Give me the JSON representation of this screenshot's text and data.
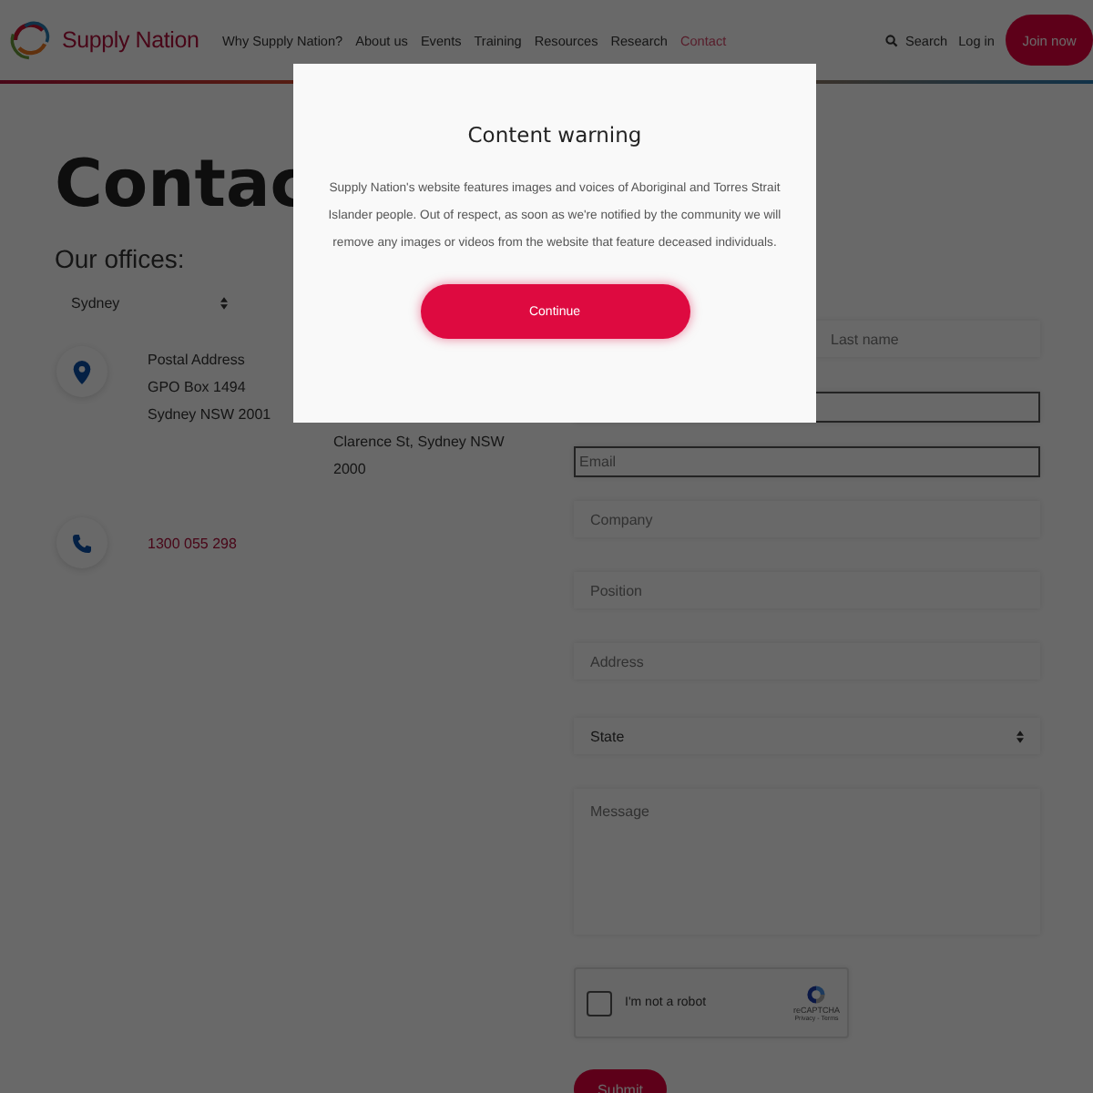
{
  "header": {
    "brand": "Supply Nation",
    "nav": [
      {
        "label": "Why Supply Nation?",
        "selected": false
      },
      {
        "label": "About us",
        "selected": false
      },
      {
        "label": "Events",
        "selected": false
      },
      {
        "label": "Training",
        "selected": false
      },
      {
        "label": "Resources",
        "selected": false
      },
      {
        "label": "Research",
        "selected": false
      },
      {
        "label": "Contact",
        "selected": true
      }
    ],
    "search": "Search",
    "login": "Log in",
    "join": "Join now"
  },
  "page": {
    "title": "Contac",
    "offices_heading": "Our offices:",
    "office_select": "Sydney",
    "address_column_1": [
      "Postal Address",
      "GPO Box 1494",
      "Sydney NSW 2001"
    ],
    "address_column_2": "Clarence St, Sydney NSW 2000",
    "phone": "1300 055 298"
  },
  "form": {
    "fields": [
      {
        "kind": "half",
        "placeholder": "Last name",
        "outlined": false
      },
      {
        "kind": "input",
        "outlined": true
      },
      {
        "kind": "input",
        "placeholder": "Email",
        "outlined": true
      },
      {
        "kind": "input",
        "placeholder": "Company",
        "outlined": false
      },
      {
        "kind": "input",
        "placeholder": "Position",
        "outlined": false
      },
      {
        "kind": "input",
        "placeholder": "Address",
        "outlined": false
      },
      {
        "kind": "select",
        "value": "State",
        "outlined": false
      },
      {
        "kind": "textarea",
        "placeholder": "Message",
        "outlined": false
      }
    ],
    "captcha": {
      "label": "I'm not a robot",
      "checked": false,
      "brand": "reCAPTCHA",
      "links": "Privacy - Terms"
    },
    "submit": "Submit"
  },
  "modal": {
    "title": "Content warning",
    "body": "Supply Nation's website features images and voices of Aboriginal and Torres Strait Islander people. Out of respect, as soon as we're notified by the community we will remove any images or videos from the website that feature deceased individuals.",
    "button": "Continue"
  }
}
